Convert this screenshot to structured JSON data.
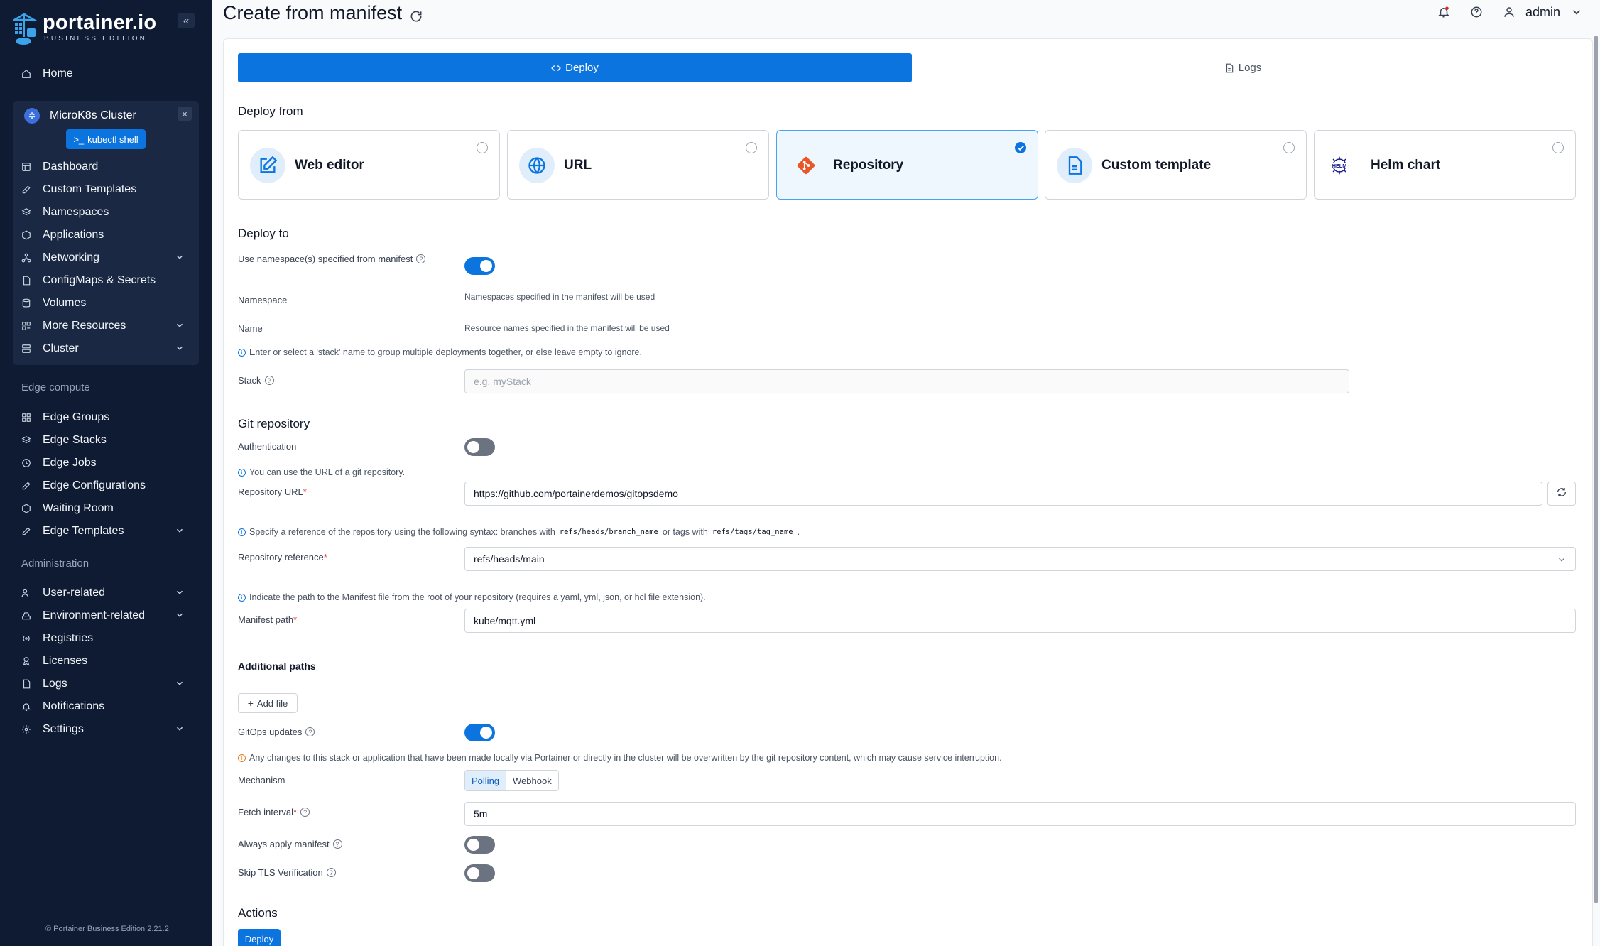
{
  "brand": {
    "name": "portainer.io",
    "edition": "BUSINESS EDITION",
    "footer": "© Portainer Business Edition 2.21.2"
  },
  "sidebar": {
    "home": "Home",
    "environment": {
      "name": "MicroK8s Cluster",
      "kubectl": "kubectl shell"
    },
    "env_items": [
      "Dashboard",
      "Custom Templates",
      "Namespaces",
      "Applications",
      "Networking",
      "ConfigMaps & Secrets",
      "Volumes",
      "More Resources",
      "Cluster"
    ],
    "edge_section": "Edge compute",
    "edge_items": [
      "Edge Groups",
      "Edge Stacks",
      "Edge Jobs",
      "Edge Configurations",
      "Waiting Room",
      "Edge Templates"
    ],
    "admin_section": "Administration",
    "admin_items": [
      "User-related",
      "Environment-related",
      "Registries",
      "Licenses",
      "Logs",
      "Notifications",
      "Settings"
    ]
  },
  "header": {
    "title": "Create from manifest",
    "user": "admin"
  },
  "tabs": {
    "deploy": "Deploy",
    "logs": "Logs"
  },
  "deploy_from": {
    "heading": "Deploy from",
    "options": [
      "Web editor",
      "URL",
      "Repository",
      "Custom template",
      "Helm chart"
    ],
    "selected": "Repository"
  },
  "deploy_to": {
    "heading": "Deploy to",
    "use_ns_label": "Use namespace(s) specified from manifest",
    "namespace_label": "Namespace",
    "namespace_help": "Namespaces specified in the manifest will be used",
    "name_label": "Name",
    "name_help": "Resource names specified in the manifest will be used",
    "stack_info": "Enter or select a 'stack' name to group multiple deployments together, or else leave empty to ignore.",
    "stack_label": "Stack",
    "stack_placeholder": "e.g. myStack"
  },
  "git": {
    "heading": "Git repository",
    "auth_label": "Authentication",
    "url_info": "You can use the URL of a git repository.",
    "url_label": "Repository URL",
    "url_value": "https://github.com/portainerdemos/gitopsdemo",
    "ref_info_a": "Specify a reference of the repository using the following syntax: branches with",
    "ref_code_a": "refs/heads/branch_name",
    "ref_info_b": "or tags with",
    "ref_code_b": "refs/tags/tag_name",
    "ref_info_c": ".",
    "ref_label": "Repository reference",
    "ref_value": "refs/heads/main",
    "path_info": "Indicate the path to the Manifest file from the root of your repository (requires a yaml, yml, json, or hcl file extension).",
    "path_label": "Manifest path",
    "path_value": "kube/mqtt.yml",
    "additional_paths": "Additional paths",
    "add_file": "Add file",
    "gitops_label": "GitOps updates",
    "gitops_warning": "Any changes to this stack or application that have been made locally via Portainer or directly in the cluster will be overwritten by the git repository content, which may cause service interruption.",
    "mechanism_label": "Mechanism",
    "mechanism_options": [
      "Polling",
      "Webhook"
    ],
    "fetch_label": "Fetch interval",
    "fetch_value": "5m",
    "always_apply_label": "Always apply manifest",
    "skip_tls_label": "Skip TLS Verification"
  },
  "actions": {
    "heading": "Actions",
    "deploy": "Deploy"
  },
  "toggles": {
    "use_namespace": true,
    "authentication": false,
    "gitops": true,
    "always_apply": false,
    "skip_tls": false
  },
  "colors": {
    "primary": "#0b74de",
    "sidebar_bg": "#0e1b33",
    "git_orange": "#e8562a",
    "helm_navy": "#0f1689"
  },
  "icons": [
    "home-icon",
    "kubernetes-icon",
    "edit-icon",
    "globe-icon",
    "git-icon",
    "file-text-icon",
    "helm-icon",
    "bell-icon",
    "help-icon",
    "user-icon"
  ]
}
